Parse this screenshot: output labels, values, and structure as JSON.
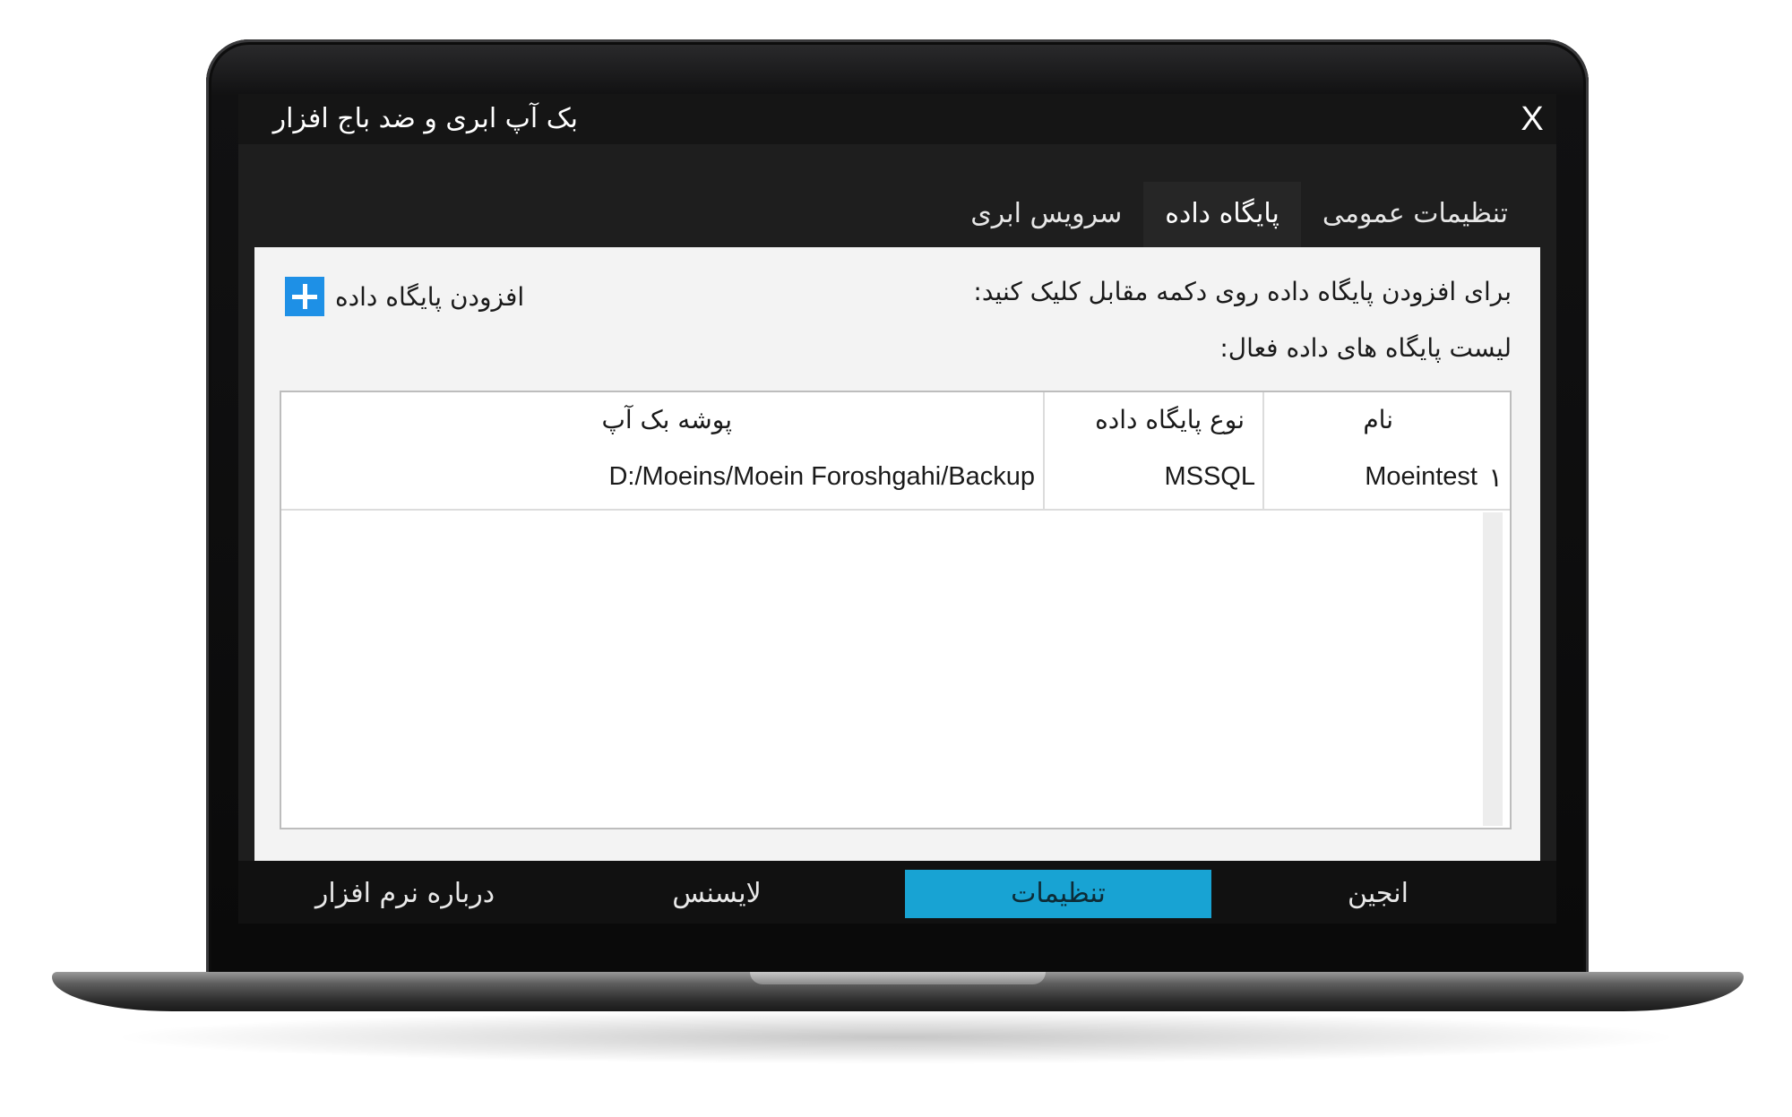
{
  "window": {
    "title": "بک آپ ابری و ضد باج افزار",
    "close_label": "X"
  },
  "tabs": [
    {
      "label": "تنظیمات عمومی",
      "active": false
    },
    {
      "label": "پایگاه داده",
      "active": true
    },
    {
      "label": "سرویس ابری",
      "active": false
    }
  ],
  "panel": {
    "add_hint": "برای افزودن پایگاه داده روی دکمه مقابل کلیک کنید:",
    "add_button_label": "افزودن پایگاه داده",
    "list_title": "لیست پایگاه های داده فعال:"
  },
  "table": {
    "columns": [
      "نام",
      "نوع پایگاه داده",
      "پوشه بک آپ"
    ],
    "rows": [
      {
        "index": "۱",
        "name": "Moeintest",
        "type": "MSSQL",
        "folder": "D:/Moeins/Moein Foroshgahi/Backup"
      }
    ]
  },
  "bottom_nav": [
    {
      "label": "انجین",
      "active": false
    },
    {
      "label": "تنظیمات",
      "active": true
    },
    {
      "label": "لایسنس",
      "active": false
    },
    {
      "label": "درباره نرم افزار",
      "active": false
    }
  ],
  "colors": {
    "accent": "#18a3d3",
    "add_icon": "#1e90e6",
    "window_bg": "#1e1e1e",
    "panel_bg": "#f3f3f3"
  }
}
